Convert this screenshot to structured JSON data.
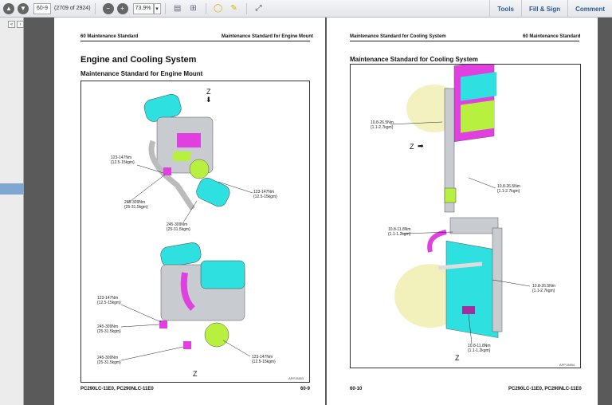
{
  "toolbar": {
    "page_value": "60-9",
    "page_count": "(2709 of 2924)",
    "zoom_value": "73.9%",
    "tools": "Tools",
    "fill_sign": "Fill & Sign",
    "comment": "Comment"
  },
  "left_page": {
    "header_left": "60 Maintenance Standard",
    "header_right": "Maintenance Standard for Engine Mount",
    "title": "Engine and Cooling System",
    "subtitle": "Maintenance Standard for Engine Mount",
    "figure": {
      "view_label_top": "Z",
      "labels": [
        {
          "nm": "123-147Nm",
          "kg": "{12.5-15kgm}"
        },
        {
          "nm": "245-309Nm",
          "kg": "{25-31.5kgm}"
        },
        {
          "nm": "123-147Nm",
          "kg": "{12.5-15kgm}"
        },
        {
          "nm": "245-309Nm",
          "kg": "{25-31.5kgm}"
        },
        {
          "nm": "123-147Nm",
          "kg": "{12.5-15kgm}"
        },
        {
          "nm": "245-309Nm",
          "kg": "{25-31.5kgm}"
        },
        {
          "nm": "245-309Nm",
          "kg": "{25-31.5kgm}"
        },
        {
          "nm": "123-147Nm",
          "kg": "{12.5-15kgm}"
        }
      ],
      "view_label_bottom": "Z",
      "code": "APP15853"
    },
    "footer_left": "PC290LC-11E0, PC290NLC-11E0",
    "footer_right": "60-9"
  },
  "right_page": {
    "header_left": "Maintenance Standard for Cooling System",
    "header_right": "60 Maintenance Standard",
    "title": "Maintenance Standard for Cooling System",
    "figure": {
      "view_label_arrow": "Z",
      "labels": [
        {
          "nm": "10.8-26.5Nm",
          "kg": "{1.1-2.7kgm}"
        },
        {
          "nm": "10.8-26.5Nm",
          "kg": "{1.1-2.7kgm}"
        },
        {
          "nm": "10.8-11.8Nm",
          "kg": "{1.1-1.2kgm}"
        },
        {
          "nm": "10.8-26.5Nm",
          "kg": "{1.1-2.7kgm}"
        },
        {
          "nm": "10.8-11.8Nm",
          "kg": "{1.1-1.2kgm}"
        }
      ],
      "view_label_bottom": "Z",
      "code": "APP15854"
    },
    "footer_left": "60-10",
    "footer_right": "PC290LC-11E0, PC290NLC-11E0"
  },
  "colors": {
    "cyan": "#2fe0e0",
    "magenta": "#e040e0",
    "lime": "#b8f040",
    "grey": "#b8bcc0",
    "link": "#2b5a8c"
  }
}
